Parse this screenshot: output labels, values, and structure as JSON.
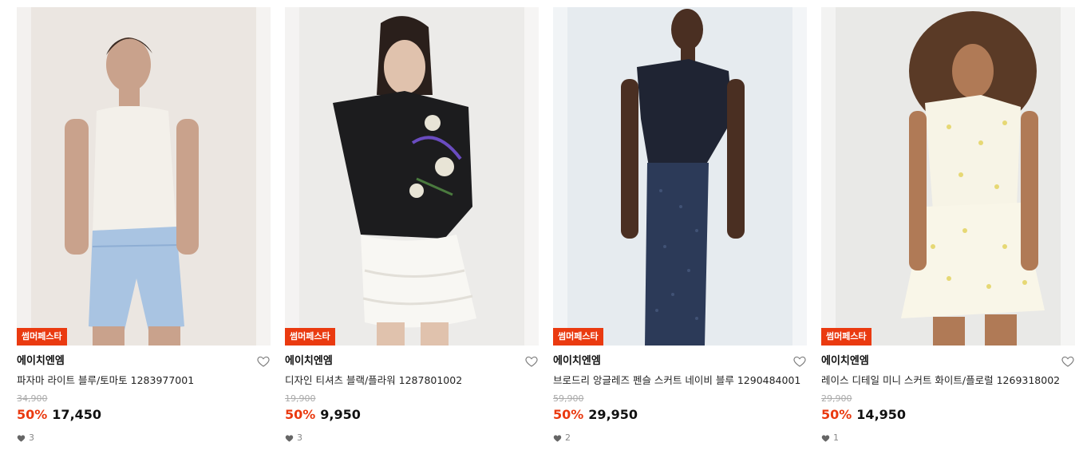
{
  "products": [
    {
      "badge": "썸머페스타",
      "brand": "에이치엔엠",
      "name": "파자마 라이트 블루/토마토 1283977001",
      "original_price": "34,900",
      "discount": "50%",
      "price": "17,450",
      "likes": "3"
    },
    {
      "badge": "썸머페스타",
      "brand": "에이치엔엠",
      "name": "디자인 티셔츠 블랙/플라워 1287801002",
      "original_price": "19,900",
      "discount": "50%",
      "price": "9,950",
      "likes": "3"
    },
    {
      "badge": "썸머페스타",
      "brand": "에이치엔엠",
      "name": "브로드리 앙글레즈 펜슬 스커트 네이비 블루 1290484001",
      "original_price": "59,900",
      "discount": "50%",
      "price": "29,950",
      "likes": "2"
    },
    {
      "badge": "썸머페스타",
      "brand": "에이치엔엠",
      "name": "레이스 디테일 미니 스커트 화이트/플로럴 1269318002",
      "original_price": "29,900",
      "discount": "50%",
      "price": "14,950",
      "likes": "1"
    }
  ],
  "colors": {
    "accent": "#ea3a10",
    "text": "#111111",
    "muted": "#aaaaaa"
  },
  "icons": {
    "wishlist": "heart-outline-icon",
    "likes": "heart-filled-icon"
  }
}
